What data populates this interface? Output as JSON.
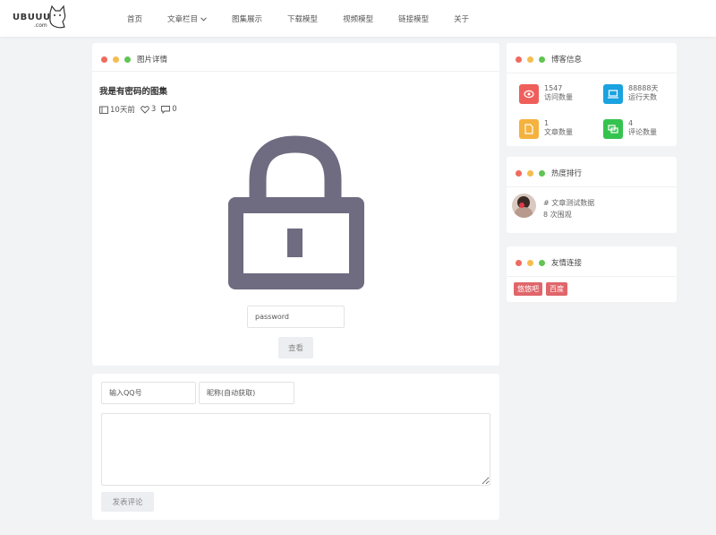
{
  "brand": {
    "logo_text": "UBUUU",
    "logo_sub": ".com"
  },
  "nav": [
    {
      "label": "首页"
    },
    {
      "label": "文章栏目",
      "has_dropdown": true
    },
    {
      "label": "图集展示"
    },
    {
      "label": "下载模型"
    },
    {
      "label": "视频模型"
    },
    {
      "label": "链接模型"
    },
    {
      "label": "关于"
    }
  ],
  "main": {
    "card_title": "图片详情",
    "post_title": "我是有密码的图集",
    "meta": {
      "time": "10天前",
      "likes": "3",
      "comments": "0"
    },
    "password_placeholder": "password",
    "view_button": "查看"
  },
  "comment": {
    "qq_placeholder": "输入QQ号",
    "nick_placeholder": "昵称(自动获取)",
    "submit_label": "发表评论"
  },
  "sidebar": {
    "info": {
      "title": "博客信息",
      "stats": [
        {
          "value": "1547",
          "label": "访问数量",
          "color": "#ee5f5b",
          "icon": "eye-icon"
        },
        {
          "value": "88888天",
          "label": "运行天数",
          "color": "#1ba2e0",
          "icon": "monitor-icon"
        },
        {
          "value": "1",
          "label": "文章数量",
          "color": "#f5b23e",
          "icon": "document-icon"
        },
        {
          "value": "4",
          "label": "评论数量",
          "color": "#35c34f",
          "icon": "comment-icon"
        }
      ]
    },
    "rank": {
      "title": "热度排行",
      "item_title": "# 文章测试数据",
      "item_views": "8 次围观"
    },
    "links": {
      "title": "友情连接",
      "items": [
        "悠悠吧",
        "百度"
      ],
      "tag_color": "#e0666a"
    }
  },
  "colors": {
    "dot_red": "#ee6b5f",
    "dot_yellow": "#f5bd4f",
    "dot_green": "#61c454",
    "lock": "#6f6b80"
  }
}
